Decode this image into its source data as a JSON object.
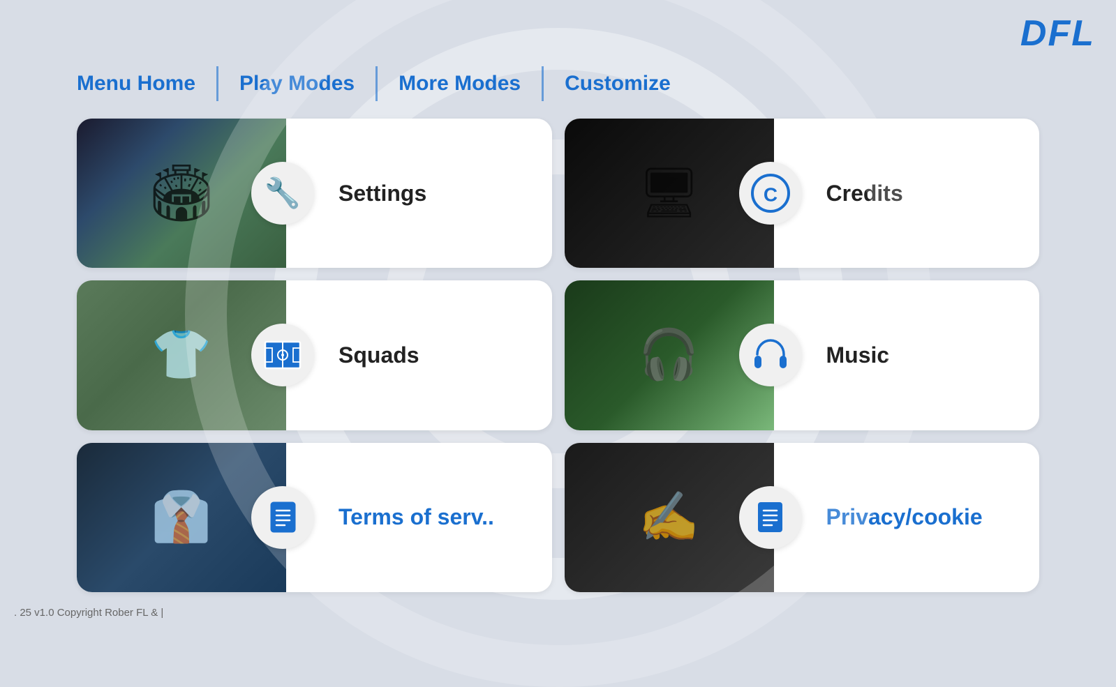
{
  "logo": "DFL",
  "nav": {
    "items": [
      {
        "id": "menu-home",
        "label": "Menu Home"
      },
      {
        "id": "play-modes",
        "label": "Play Modes"
      },
      {
        "id": "more-modes",
        "label": "More Modes"
      },
      {
        "id": "customize",
        "label": "Customize"
      }
    ]
  },
  "cards": [
    {
      "id": "settings",
      "label": "Settings",
      "image_class": "img-stadium",
      "icon_type": "tools",
      "label_color": "dark"
    },
    {
      "id": "credits",
      "label": "Credits",
      "image_class": "img-hacker",
      "icon_type": "copyright",
      "label_color": "dark"
    },
    {
      "id": "squads",
      "label": "Squads",
      "image_class": "img-locker",
      "icon_type": "pitch",
      "label_color": "dark"
    },
    {
      "id": "music",
      "label": "Music",
      "image_class": "img-player-headphones",
      "icon_type": "headphones",
      "label_color": "dark"
    },
    {
      "id": "terms",
      "label": "Terms of serv..",
      "image_class": "img-interview",
      "icon_type": "document",
      "label_color": "blue"
    },
    {
      "id": "privacy",
      "label": "Privacy/cookie",
      "image_class": "img-signing",
      "icon_type": "document",
      "label_color": "blue"
    }
  ],
  "footer": {
    "text": ". 25 v1.0 Copyright Rober FL & |"
  }
}
